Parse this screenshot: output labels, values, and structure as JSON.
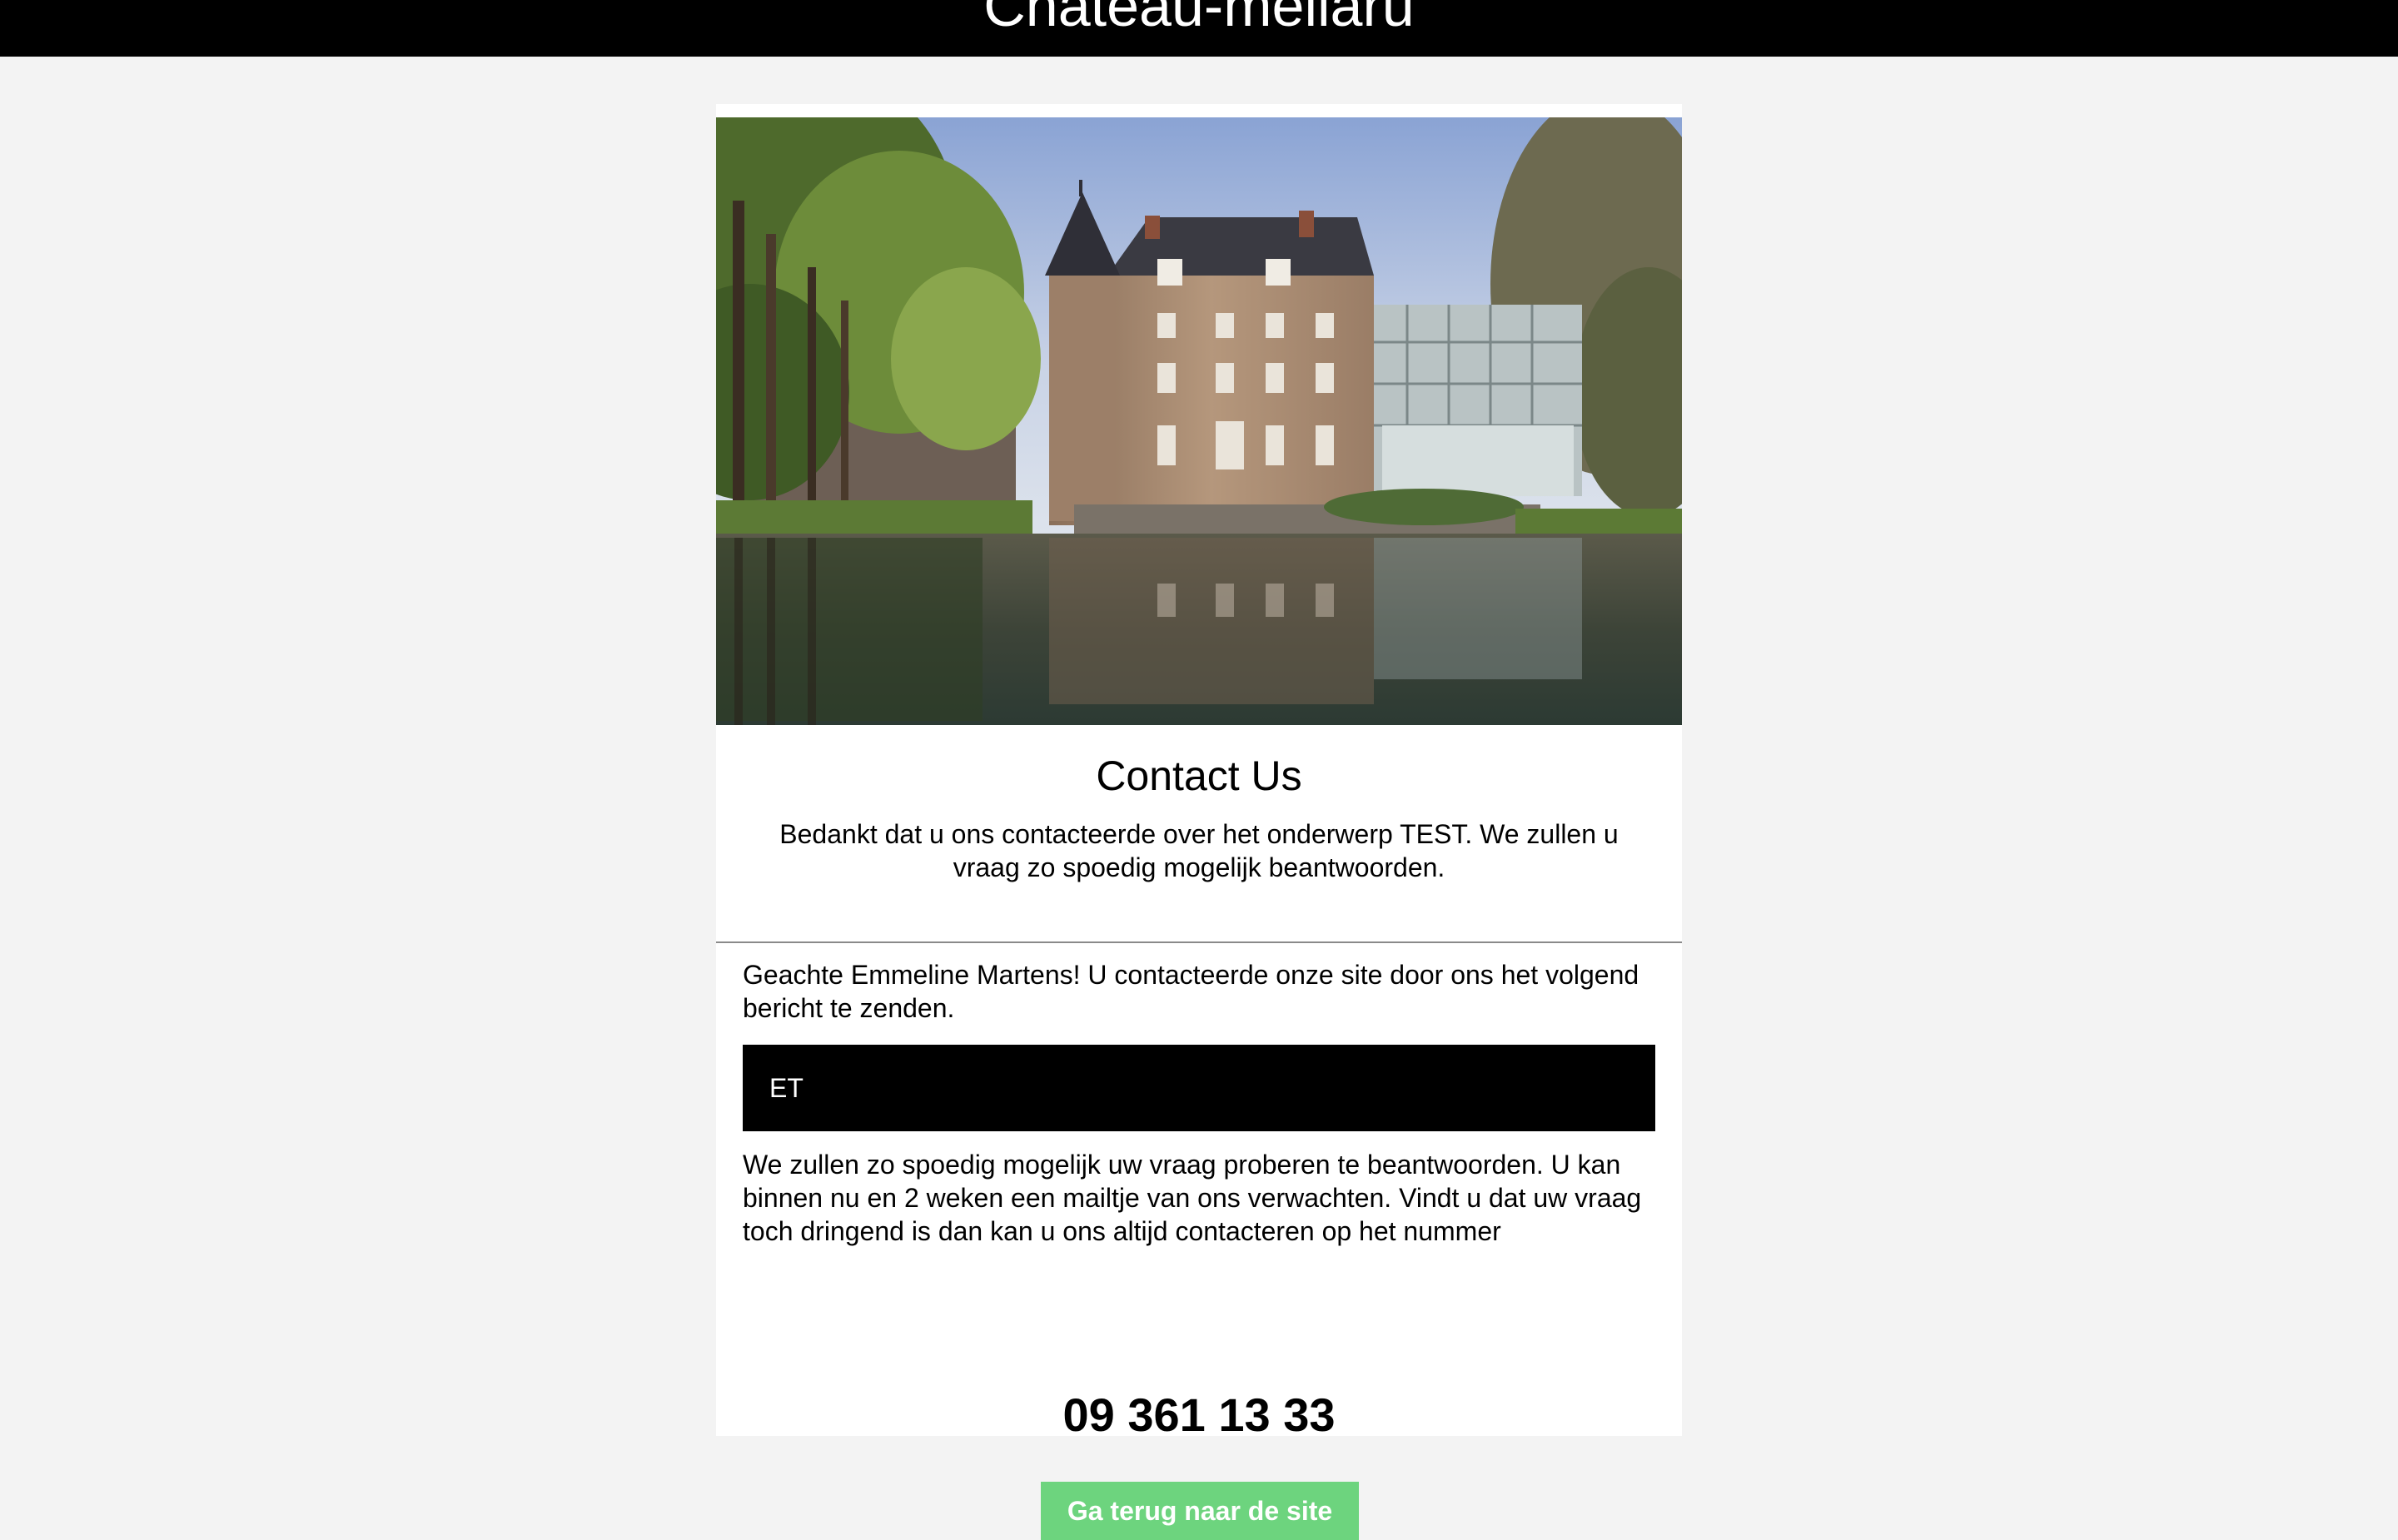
{
  "header": {
    "site_title": "Chateau-mellaru"
  },
  "hero": {
    "image_name": "chateau-photo"
  },
  "contact": {
    "heading": "Contact Us",
    "thanks": "Bedankt dat u ons contacteerde over het onderwerp TEST. We zullen u vraag zo spoedig mogelijk beantwoorden."
  },
  "message": {
    "greeting": "Geachte Emmeline Martens! U contacteerde onze site door ons het volgend bericht te zenden.",
    "body": "ET",
    "info": "We zullen zo spoedig mogelijk uw vraag proberen te beantwoorden. U kan binnen nu en 2 weken een mailtje van ons verwachten. Vindt u dat uw vraag toch dringend is dan kan u ons altijd contacteren op het nummer",
    "phone": "09 361 13 33"
  },
  "actions": {
    "back_label": "Ga terug naar de site"
  },
  "colors": {
    "header_bg": "#000000",
    "page_bg": "#f3f3f3",
    "button_bg": "#6dd47e"
  }
}
